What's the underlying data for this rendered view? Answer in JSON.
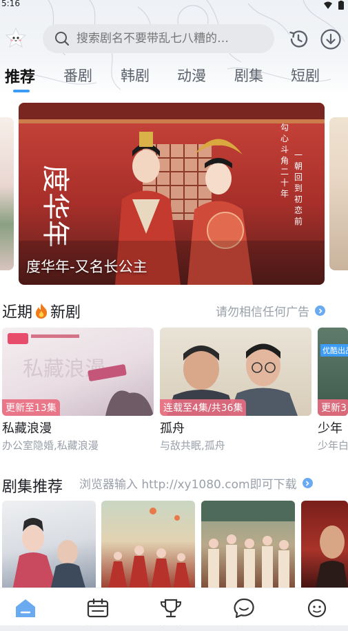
{
  "status": {
    "time": "5:16"
  },
  "search": {
    "placeholder": "搜索剧名不要带乱七八糟的…"
  },
  "tabs": [
    {
      "label": "推荐",
      "active": true
    },
    {
      "label": "番剧"
    },
    {
      "label": "韩剧"
    },
    {
      "label": "动漫"
    },
    {
      "label": "剧集"
    },
    {
      "label": "短剧"
    }
  ],
  "banner": {
    "title": "度华年-又名长公主",
    "poster_calligraphy": "度华年",
    "poster_tagline": "匀心斗角二十年 一朝回到初恋前"
  },
  "recent": {
    "title_prefix": "近期",
    "title_suffix": "新剧",
    "hint": "请勿相信任何广告",
    "items": [
      {
        "badge": "更新至13集",
        "name": "私藏浪漫",
        "desc": "办公室隐婚,私藏浪漫",
        "thumb_text": "私藏浪漫"
      },
      {
        "badge": "连载至4集/共36集",
        "name": "孤舟",
        "desc": "与敌共眠,孤舟"
      },
      {
        "badge": "更新3",
        "name": "少年",
        "desc": "少年白",
        "corner_text": "优酷出品"
      }
    ]
  },
  "recommend": {
    "title": "剧集推荐",
    "hint": "浏览器输入 http://xy1080.com即可下载"
  },
  "nav": [
    {
      "label": "首页",
      "icon": "home-icon",
      "active": true
    },
    {
      "label": "排期表",
      "icon": "schedule-icon"
    },
    {
      "label": "排行榜",
      "icon": "trophy-icon"
    },
    {
      "label": "社区",
      "icon": "community-icon"
    },
    {
      "label": "我的",
      "icon": "profile-icon"
    }
  ],
  "colors": {
    "accent": "#3c9cf5",
    "badge": "#e96c80",
    "banner_red": "#b8322c"
  }
}
